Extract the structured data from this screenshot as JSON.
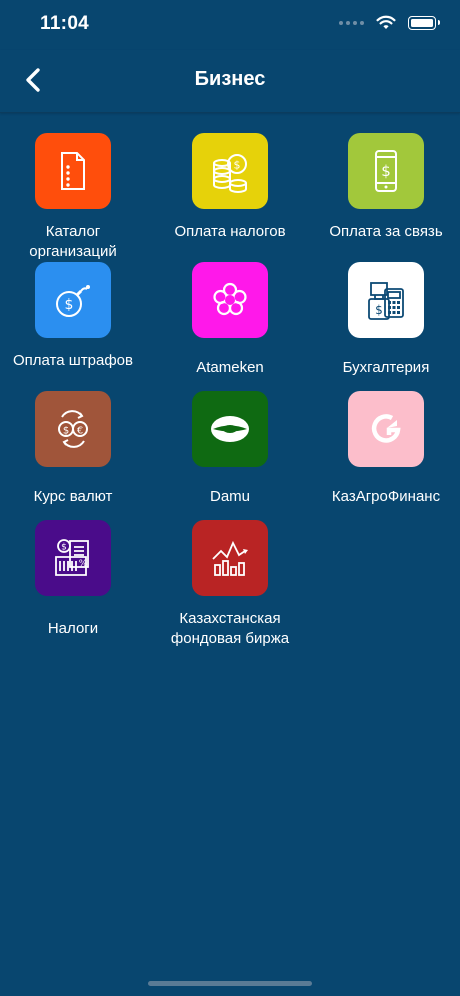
{
  "status": {
    "time": "11:04"
  },
  "header": {
    "title": "Бизнес"
  },
  "tiles": [
    {
      "label": "Каталог организаций",
      "color": "#ff4e0c",
      "icon": "document-list-icon"
    },
    {
      "label": "Оплата налогов",
      "color": "#e6d20a",
      "icon": "coins-icon"
    },
    {
      "label": "Оплата за связь",
      "color": "#a2c83b",
      "icon": "smartphone-dollar-icon"
    },
    {
      "label": "Оплата штрафов",
      "color": "#2b8ff0",
      "icon": "dollar-bomb-icon"
    },
    {
      "label": "Atameken",
      "color": "#ff18ea",
      "icon": "atameken-logo-icon"
    },
    {
      "label": "Бухгалтерия",
      "color": "#ffffff",
      "icon": "accounting-calculator-icon"
    },
    {
      "label": "Курс валют",
      "color": "#a0553a",
      "icon": "currency-exchange-icon"
    },
    {
      "label": "Damu",
      "color": "#0f6a12",
      "icon": "damu-logo-icon"
    },
    {
      "label": "КазАгроФинанс",
      "color": "#fcbecb",
      "icon": "kazagrofinance-logo-icon"
    },
    {
      "label": "Налоги",
      "color": "#4a0c8a",
      "icon": "tax-documents-icon"
    },
    {
      "label": "Казахстанская фондовая биржа",
      "color": "#b92424",
      "icon": "stock-chart-icon"
    }
  ]
}
